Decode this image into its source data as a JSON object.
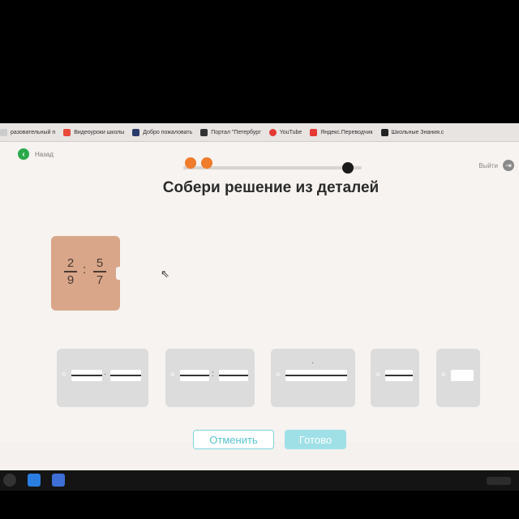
{
  "bookmarks": [
    {
      "label": "разовательный п",
      "icon": "page-icon",
      "color": "#cccccc"
    },
    {
      "label": "Видеоуроки школы",
      "icon": "play-icon",
      "color": "#e84b3a"
    },
    {
      "label": "Добро пожаловать",
      "icon": "app-icon",
      "color": "#2a3b6b"
    },
    {
      "label": "Портал \"Петербург",
      "icon": "emblem-icon",
      "color": "#333333"
    },
    {
      "label": "YouTube",
      "icon": "youtube-icon",
      "color": "#e53935"
    },
    {
      "label": "Яндекс.Переводчик",
      "icon": "translate-icon",
      "color": "#e53935"
    },
    {
      "label": "Школьные Знания.c",
      "icon": "znania-icon",
      "color": "#222222"
    }
  ],
  "nav": {
    "back_label": "Назад",
    "back_icon": "chevron-left-icon",
    "exit_label": "Выйти",
    "exit_icon": "exit-icon"
  },
  "progress": {
    "completed_steps": 2,
    "accent": "#f07b2b",
    "final_color": "#1a1a1a"
  },
  "title": "Собери решение из деталей",
  "expression": {
    "left_num": "2",
    "left_den": "9",
    "operator": ":",
    "right_num": "5",
    "right_den": "7"
  },
  "slots": [
    {
      "eq": "=",
      "sep": "·"
    },
    {
      "eq": "=",
      "sep": ":"
    },
    {
      "eq": "=",
      "sep": "·"
    },
    {
      "eq": "=",
      "sep": ""
    },
    {
      "eq": "=",
      "sep": ""
    }
  ],
  "buttons": {
    "cancel": "Отменить",
    "done": "Готово"
  },
  "colors": {
    "card": "#d9a68a",
    "primary": "#58c3d3",
    "back": "#2aa84a"
  }
}
